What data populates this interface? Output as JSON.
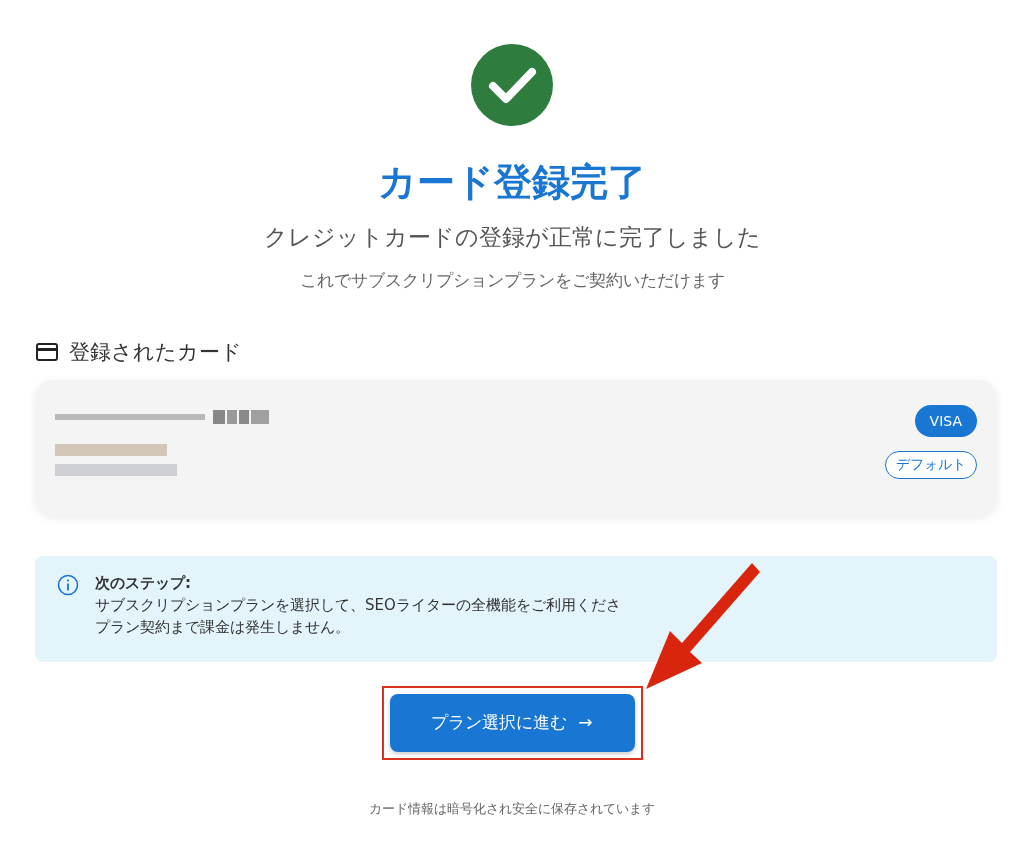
{
  "title": "カード登録完了",
  "subtitle": "クレジットカードの登録が正常に完了しました",
  "description": "これでサブスクリプションプランをご契約いただけます",
  "registered_card": {
    "heading": "登録されたカード",
    "brand": "VISA",
    "badge": "デフォルト"
  },
  "next_step": {
    "heading": "次のステップ:",
    "lines": [
      "サブスクリプションプランを選択して、SEOライターの全機能をご利用くださ",
      "プラン契約まで課金は発生しません。"
    ]
  },
  "button": {
    "label": "プラン選択に進む",
    "icon": "→",
    "highlighted": true
  },
  "footer": "カード情報は暗号化され安全に保存されています"
}
